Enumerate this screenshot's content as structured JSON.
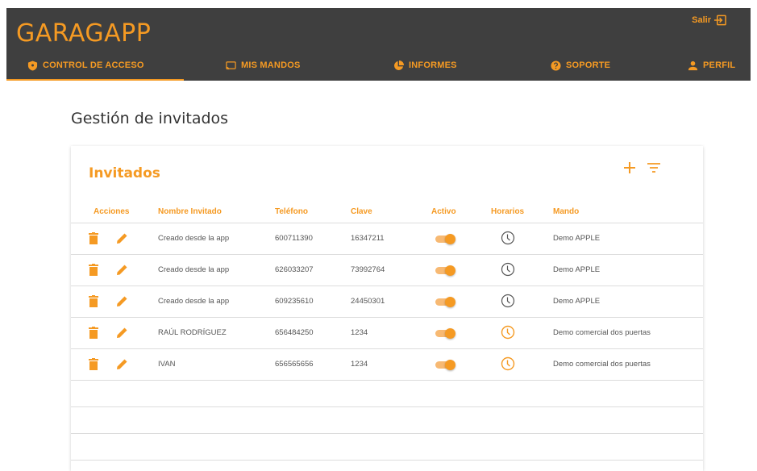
{
  "app": {
    "brand": "GARAGAPP",
    "logout_label": "Salir"
  },
  "nav": {
    "tabs": [
      {
        "label": "CONTROL DE ACCESO",
        "icon": "shield-icon",
        "active": true
      },
      {
        "label": "MIS MANDOS",
        "icon": "cast-icon"
      },
      {
        "label": "INFORMES",
        "icon": "pie-chart-icon"
      },
      {
        "label": "SOPORTE",
        "icon": "help-icon"
      },
      {
        "label": "PERFIL",
        "icon": "person-icon"
      }
    ]
  },
  "main": {
    "title": "Gestión de invitados",
    "card": {
      "title": "Invitados",
      "columns": [
        "Acciones",
        "Nombre Invitado",
        "Teléfono",
        "Clave",
        "Activo",
        "Horarios",
        "Mando"
      ],
      "rows": [
        {
          "name": "Creado desde la app",
          "phone": "600711390",
          "key": "16347211",
          "active": true,
          "schedule": "inactive",
          "mando": "Demo APPLE"
        },
        {
          "name": "Creado desde la app",
          "phone": "626033207",
          "key": "73992764",
          "active": true,
          "schedule": "inactive",
          "mando": "Demo APPLE"
        },
        {
          "name": "Creado desde la app",
          "phone": "609235610",
          "key": "24450301",
          "active": true,
          "schedule": "inactive",
          "mando": "Demo APPLE"
        },
        {
          "name": "RAÚL RODRÍGUEZ",
          "phone": "656484250",
          "key": "1234",
          "active": true,
          "schedule": "active",
          "mando": "Demo comercial dos puertas"
        },
        {
          "name": "IVAN",
          "phone": "656565656",
          "key": "1234",
          "active": true,
          "schedule": "active",
          "mando": "Demo comercial dos puertas"
        }
      ]
    }
  },
  "colors": {
    "accent": "#f59a23",
    "topbar": "#3f3f3f",
    "clock_inactive": "#555555"
  }
}
